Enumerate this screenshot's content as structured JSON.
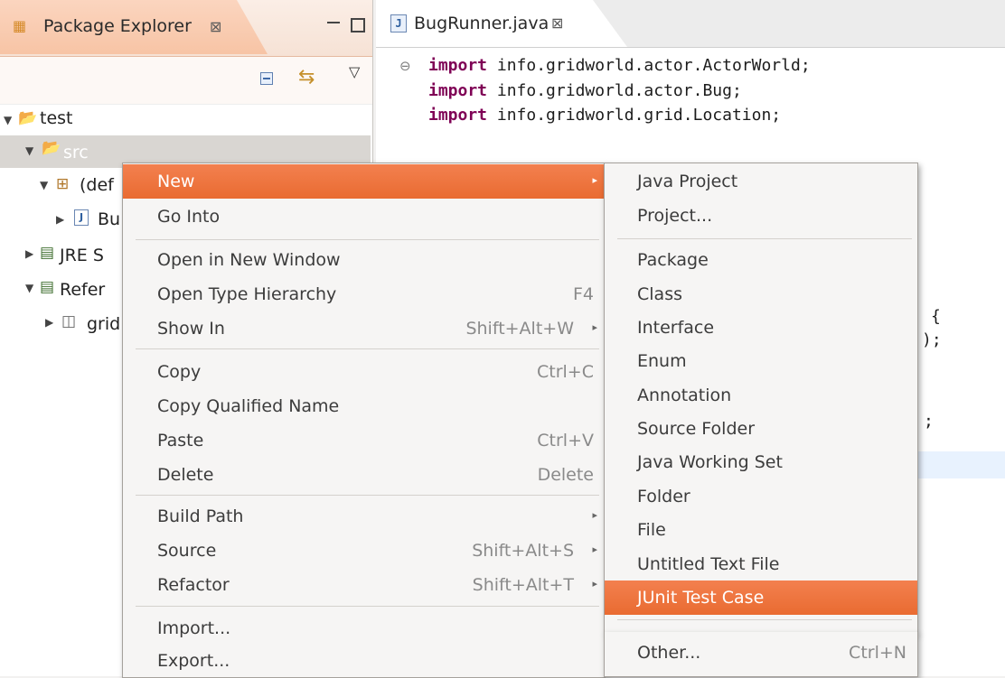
{
  "package_explorer": {
    "title": "Package Explorer",
    "close_glyph": "⊠",
    "tree": {
      "project": "test",
      "src": "src",
      "package": "(def",
      "file": "Bu",
      "jre": "JRE S",
      "referenced": "Refer",
      "jar": "grid"
    }
  },
  "editor": {
    "tab_title": "BugRunner.java",
    "tab_icon_letter": "J",
    "close_glyph": "⊠",
    "lines": [
      {
        "kw": "import",
        "rest": " info.gridworld.actor.ActorWorld;"
      },
      {
        "kw": "import",
        "rest": " info.gridworld.actor.Bug;"
      },
      {
        "kw": "import",
        "rest": " info.gridworld.grid.Location;"
      }
    ],
    "fragments": {
      "brace": "{",
      "paren": ");",
      "semi": ";"
    }
  },
  "context_menu": {
    "items": [
      {
        "label": "New",
        "has_submenu": true
      },
      {
        "label": "Go Into"
      },
      {
        "label": "Open in New Window"
      },
      {
        "label": "Open Type Hierarchy",
        "accel": "F4"
      },
      {
        "label": "Show In",
        "accel": "Shift+Alt+W"
      },
      {
        "label": "Copy",
        "accel": "Ctrl+C"
      },
      {
        "label": "Copy Qualified Name"
      },
      {
        "label": "Paste",
        "accel": "Ctrl+V"
      },
      {
        "label": "Delete",
        "accel": "Delete"
      },
      {
        "label": "Build Path"
      },
      {
        "label": "Source",
        "accel": "Shift+Alt+S"
      },
      {
        "label": "Refactor",
        "accel": "Shift+Alt+T"
      },
      {
        "label": "Import..."
      },
      {
        "label": "Export..."
      }
    ]
  },
  "submenu": {
    "items": [
      {
        "label": "Java Project"
      },
      {
        "label": "Project..."
      },
      {
        "label": "Package"
      },
      {
        "label": "Class"
      },
      {
        "label": "Interface"
      },
      {
        "label": "Enum"
      },
      {
        "label": "Annotation"
      },
      {
        "label": "Source Folder"
      },
      {
        "label": "Java Working Set"
      },
      {
        "label": "Folder"
      },
      {
        "label": "File"
      },
      {
        "label": "Untitled Text File"
      },
      {
        "label": "JUnit Test Case"
      },
      {
        "label": "Other...",
        "accel": "Ctrl+N"
      }
    ]
  },
  "colors": {
    "highlight": "#ef7840",
    "keyword": "#7f0055"
  }
}
